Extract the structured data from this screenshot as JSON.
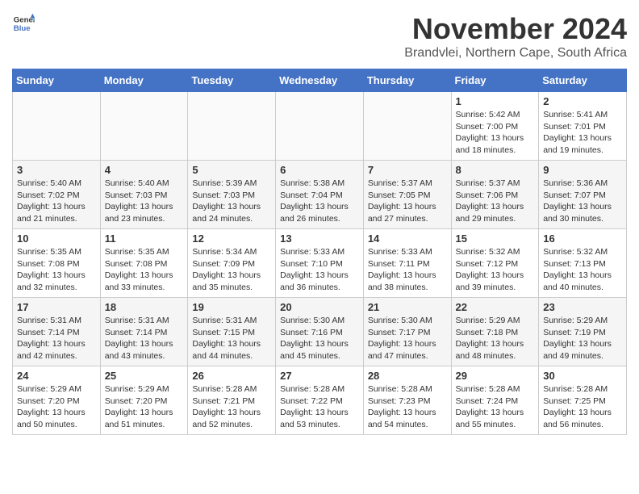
{
  "header": {
    "logo_general": "General",
    "logo_blue": "Blue",
    "month_title": "November 2024",
    "location": "Brandvlei, Northern Cape, South Africa"
  },
  "weekdays": [
    "Sunday",
    "Monday",
    "Tuesday",
    "Wednesday",
    "Thursday",
    "Friday",
    "Saturday"
  ],
  "weeks": [
    [
      {
        "day": "",
        "info": ""
      },
      {
        "day": "",
        "info": ""
      },
      {
        "day": "",
        "info": ""
      },
      {
        "day": "",
        "info": ""
      },
      {
        "day": "",
        "info": ""
      },
      {
        "day": "1",
        "info": "Sunrise: 5:42 AM\nSunset: 7:00 PM\nDaylight: 13 hours and 18 minutes."
      },
      {
        "day": "2",
        "info": "Sunrise: 5:41 AM\nSunset: 7:01 PM\nDaylight: 13 hours and 19 minutes."
      }
    ],
    [
      {
        "day": "3",
        "info": "Sunrise: 5:40 AM\nSunset: 7:02 PM\nDaylight: 13 hours and 21 minutes."
      },
      {
        "day": "4",
        "info": "Sunrise: 5:40 AM\nSunset: 7:03 PM\nDaylight: 13 hours and 23 minutes."
      },
      {
        "day": "5",
        "info": "Sunrise: 5:39 AM\nSunset: 7:03 PM\nDaylight: 13 hours and 24 minutes."
      },
      {
        "day": "6",
        "info": "Sunrise: 5:38 AM\nSunset: 7:04 PM\nDaylight: 13 hours and 26 minutes."
      },
      {
        "day": "7",
        "info": "Sunrise: 5:37 AM\nSunset: 7:05 PM\nDaylight: 13 hours and 27 minutes."
      },
      {
        "day": "8",
        "info": "Sunrise: 5:37 AM\nSunset: 7:06 PM\nDaylight: 13 hours and 29 minutes."
      },
      {
        "day": "9",
        "info": "Sunrise: 5:36 AM\nSunset: 7:07 PM\nDaylight: 13 hours and 30 minutes."
      }
    ],
    [
      {
        "day": "10",
        "info": "Sunrise: 5:35 AM\nSunset: 7:08 PM\nDaylight: 13 hours and 32 minutes."
      },
      {
        "day": "11",
        "info": "Sunrise: 5:35 AM\nSunset: 7:08 PM\nDaylight: 13 hours and 33 minutes."
      },
      {
        "day": "12",
        "info": "Sunrise: 5:34 AM\nSunset: 7:09 PM\nDaylight: 13 hours and 35 minutes."
      },
      {
        "day": "13",
        "info": "Sunrise: 5:33 AM\nSunset: 7:10 PM\nDaylight: 13 hours and 36 minutes."
      },
      {
        "day": "14",
        "info": "Sunrise: 5:33 AM\nSunset: 7:11 PM\nDaylight: 13 hours and 38 minutes."
      },
      {
        "day": "15",
        "info": "Sunrise: 5:32 AM\nSunset: 7:12 PM\nDaylight: 13 hours and 39 minutes."
      },
      {
        "day": "16",
        "info": "Sunrise: 5:32 AM\nSunset: 7:13 PM\nDaylight: 13 hours and 40 minutes."
      }
    ],
    [
      {
        "day": "17",
        "info": "Sunrise: 5:31 AM\nSunset: 7:14 PM\nDaylight: 13 hours and 42 minutes."
      },
      {
        "day": "18",
        "info": "Sunrise: 5:31 AM\nSunset: 7:14 PM\nDaylight: 13 hours and 43 minutes."
      },
      {
        "day": "19",
        "info": "Sunrise: 5:31 AM\nSunset: 7:15 PM\nDaylight: 13 hours and 44 minutes."
      },
      {
        "day": "20",
        "info": "Sunrise: 5:30 AM\nSunset: 7:16 PM\nDaylight: 13 hours and 45 minutes."
      },
      {
        "day": "21",
        "info": "Sunrise: 5:30 AM\nSunset: 7:17 PM\nDaylight: 13 hours and 47 minutes."
      },
      {
        "day": "22",
        "info": "Sunrise: 5:29 AM\nSunset: 7:18 PM\nDaylight: 13 hours and 48 minutes."
      },
      {
        "day": "23",
        "info": "Sunrise: 5:29 AM\nSunset: 7:19 PM\nDaylight: 13 hours and 49 minutes."
      }
    ],
    [
      {
        "day": "24",
        "info": "Sunrise: 5:29 AM\nSunset: 7:20 PM\nDaylight: 13 hours and 50 minutes."
      },
      {
        "day": "25",
        "info": "Sunrise: 5:29 AM\nSunset: 7:20 PM\nDaylight: 13 hours and 51 minutes."
      },
      {
        "day": "26",
        "info": "Sunrise: 5:28 AM\nSunset: 7:21 PM\nDaylight: 13 hours and 52 minutes."
      },
      {
        "day": "27",
        "info": "Sunrise: 5:28 AM\nSunset: 7:22 PM\nDaylight: 13 hours and 53 minutes."
      },
      {
        "day": "28",
        "info": "Sunrise: 5:28 AM\nSunset: 7:23 PM\nDaylight: 13 hours and 54 minutes."
      },
      {
        "day": "29",
        "info": "Sunrise: 5:28 AM\nSunset: 7:24 PM\nDaylight: 13 hours and 55 minutes."
      },
      {
        "day": "30",
        "info": "Sunrise: 5:28 AM\nSunset: 7:25 PM\nDaylight: 13 hours and 56 minutes."
      }
    ]
  ]
}
